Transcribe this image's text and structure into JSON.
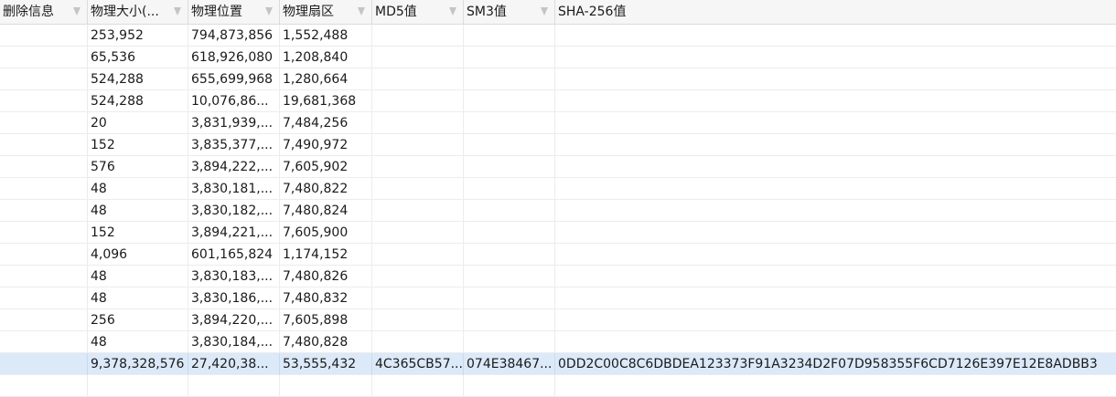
{
  "headers": [
    {
      "label": "删除信息"
    },
    {
      "label": "物理大小(..."
    },
    {
      "label": "物理位置"
    },
    {
      "label": "物理扇区"
    },
    {
      "label": "MD5值"
    },
    {
      "label": "SM3值"
    },
    {
      "label": "SHA-256值"
    }
  ],
  "rows": [
    {
      "size": "253,952",
      "pos": "794,873,856",
      "sector": "1,552,488",
      "md5": "",
      "sm3": "",
      "sha": ""
    },
    {
      "size": "65,536",
      "pos": "618,926,080",
      "sector": "1,208,840",
      "md5": "",
      "sm3": "",
      "sha": ""
    },
    {
      "size": "524,288",
      "pos": "655,699,968",
      "sector": "1,280,664",
      "md5": "",
      "sm3": "",
      "sha": ""
    },
    {
      "size": "524,288",
      "pos": "10,076,86...",
      "sector": "19,681,368",
      "md5": "",
      "sm3": "",
      "sha": ""
    },
    {
      "size": "20",
      "pos": "3,831,939,...",
      "sector": "7,484,256",
      "md5": "",
      "sm3": "",
      "sha": ""
    },
    {
      "size": "152",
      "pos": "3,835,377,...",
      "sector": "7,490,972",
      "md5": "",
      "sm3": "",
      "sha": ""
    },
    {
      "size": "576",
      "pos": "3,894,222,...",
      "sector": "7,605,902",
      "md5": "",
      "sm3": "",
      "sha": ""
    },
    {
      "size": "48",
      "pos": "3,830,181,...",
      "sector": "7,480,822",
      "md5": "",
      "sm3": "",
      "sha": ""
    },
    {
      "size": "48",
      "pos": "3,830,182,...",
      "sector": "7,480,824",
      "md5": "",
      "sm3": "",
      "sha": ""
    },
    {
      "size": "152",
      "pos": "3,894,221,...",
      "sector": "7,605,900",
      "md5": "",
      "sm3": "",
      "sha": ""
    },
    {
      "size": "4,096",
      "pos": "601,165,824",
      "sector": "1,174,152",
      "md5": "",
      "sm3": "",
      "sha": ""
    },
    {
      "size": "48",
      "pos": "3,830,183,...",
      "sector": "7,480,826",
      "md5": "",
      "sm3": "",
      "sha": ""
    },
    {
      "size": "48",
      "pos": "3,830,186,...",
      "sector": "7,480,832",
      "md5": "",
      "sm3": "",
      "sha": ""
    },
    {
      "size": "256",
      "pos": "3,894,220,...",
      "sector": "7,605,898",
      "md5": "",
      "sm3": "",
      "sha": ""
    },
    {
      "size": "48",
      "pos": "3,830,184,...",
      "sector": "7,480,828",
      "md5": "",
      "sm3": "",
      "sha": ""
    },
    {
      "size": "9,378,328,576",
      "pos": "27,420,38...",
      "sector": "53,555,432",
      "md5": "4C365CB57...",
      "sm3": "074E38467...",
      "sha": "0DD2C00C8C6DBDEA123373F91A3234D2F07D958355F6CD7126E397E12E8ADBB3"
    }
  ],
  "selected_row": 15,
  "colors": {
    "header_bg": "#f6f6f6",
    "selected_bg": "#dbe9f9",
    "grid_line": "#ececec",
    "filter_icon": "#c4c4c4"
  }
}
